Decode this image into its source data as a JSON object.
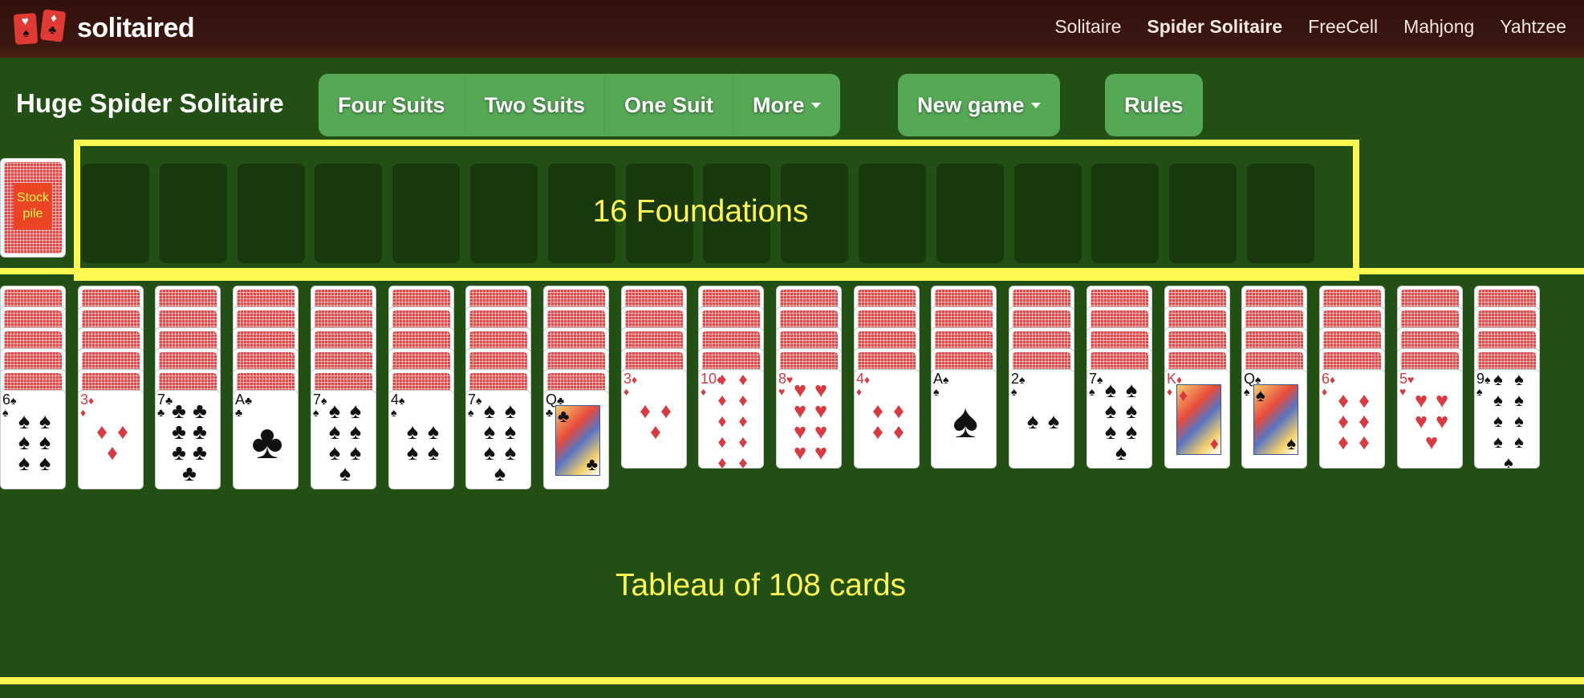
{
  "header": {
    "logo_text": "solitaired",
    "logo_cards": [
      {
        "top": "♥",
        "bottom": "♠"
      },
      {
        "top": "♦",
        "bottom": "♣"
      }
    ],
    "nav": [
      {
        "label": "Solitaire",
        "active": false
      },
      {
        "label": "Spider Solitaire",
        "active": true
      },
      {
        "label": "FreeCell",
        "active": false
      },
      {
        "label": "Mahjong",
        "active": false
      },
      {
        "label": "Yahtzee",
        "active": false
      }
    ]
  },
  "toolbar": {
    "title": "Huge Spider Solitaire",
    "variants": [
      "Four Suits",
      "Two Suits",
      "One Suit"
    ],
    "more_label": "More",
    "new_game_label": "New game",
    "rules_label": "Rules"
  },
  "stock": {
    "label": "Stock pile"
  },
  "foundations": {
    "label": "16 Foundations",
    "count": 16
  },
  "tableau": {
    "label": "Tableau of 108 cards",
    "columns": [
      {
        "hidden": 5,
        "top": {
          "rank": "6",
          "suit": "♠"
        }
      },
      {
        "hidden": 5,
        "top": {
          "rank": "3",
          "suit": "♦"
        }
      },
      {
        "hidden": 5,
        "top": {
          "rank": "7",
          "suit": "♣"
        }
      },
      {
        "hidden": 5,
        "top": {
          "rank": "A",
          "suit": "♣"
        }
      },
      {
        "hidden": 5,
        "top": {
          "rank": "7",
          "suit": "♠"
        }
      },
      {
        "hidden": 5,
        "top": {
          "rank": "4",
          "suit": "♠"
        }
      },
      {
        "hidden": 5,
        "top": {
          "rank": "7",
          "suit": "♠"
        }
      },
      {
        "hidden": 5,
        "top": {
          "rank": "Q",
          "suit": "♣"
        }
      },
      {
        "hidden": 4,
        "top": {
          "rank": "3",
          "suit": "♦"
        }
      },
      {
        "hidden": 4,
        "top": {
          "rank": "10",
          "suit": "♦"
        }
      },
      {
        "hidden": 4,
        "top": {
          "rank": "8",
          "suit": "♥"
        }
      },
      {
        "hidden": 4,
        "top": {
          "rank": "4",
          "suit": "♦"
        }
      },
      {
        "hidden": 4,
        "top": {
          "rank": "A",
          "suit": "♠"
        }
      },
      {
        "hidden": 4,
        "top": {
          "rank": "2",
          "suit": "♠"
        }
      },
      {
        "hidden": 4,
        "top": {
          "rank": "7",
          "suit": "♠"
        }
      },
      {
        "hidden": 4,
        "top": {
          "rank": "K",
          "suit": "♦"
        }
      },
      {
        "hidden": 4,
        "top": {
          "rank": "Q",
          "suit": "♠"
        }
      },
      {
        "hidden": 4,
        "top": {
          "rank": "6",
          "suit": "♦"
        }
      },
      {
        "hidden": 4,
        "top": {
          "rank": "5",
          "suit": "♥"
        }
      },
      {
        "hidden": 4,
        "top": {
          "rank": "9",
          "suit": "♠"
        }
      }
    ]
  },
  "colors": {
    "felt": "#214f14",
    "header": "#35120a",
    "button": "#55a855",
    "highlight": "#fff951",
    "card_back": "#e04848",
    "red_suit": "#d83a42"
  }
}
